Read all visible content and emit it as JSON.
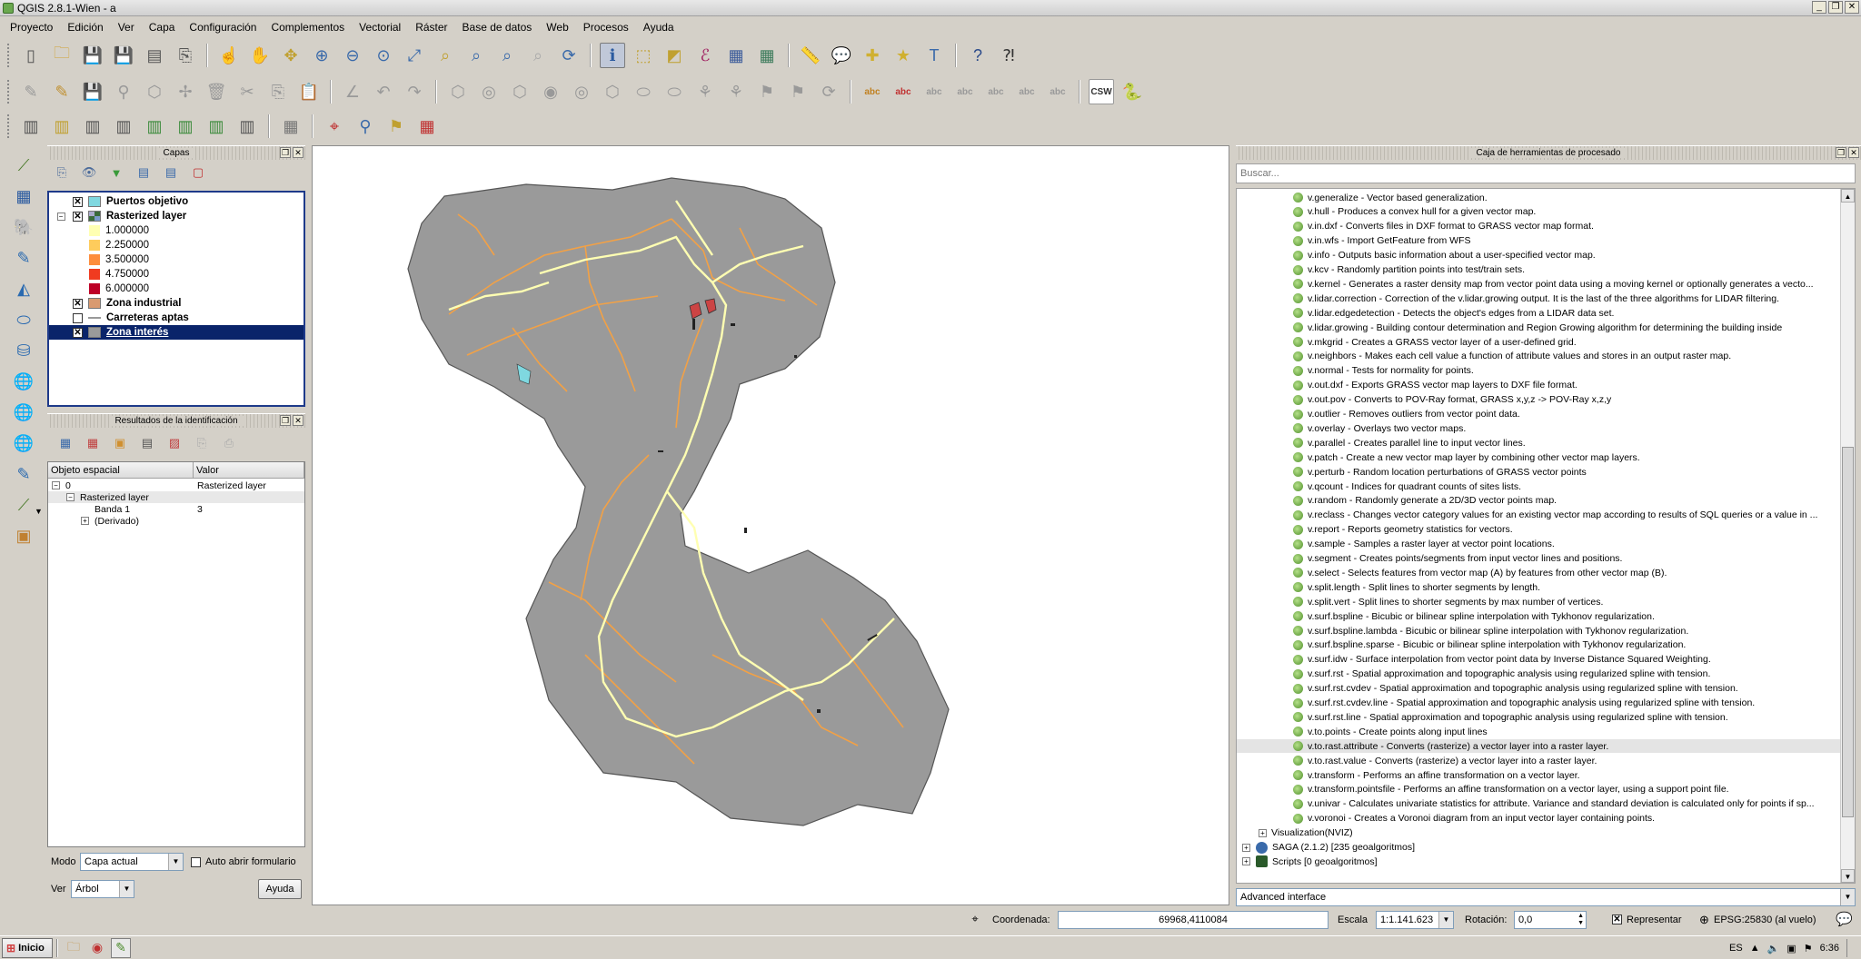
{
  "window": {
    "title": "QGIS 2.8.1-Wien - a"
  },
  "menus": [
    "Proyecto",
    "Edición",
    "Ver",
    "Capa",
    "Configuración",
    "Complementos",
    "Vectorial",
    "Ráster",
    "Base de datos",
    "Web",
    "Procesos",
    "Ayuda"
  ],
  "toolbars": {
    "main_icons": [
      "new-project-icon",
      "open-project-icon",
      "save-project-icon",
      "save-as-icon",
      "new-print-composer-icon",
      "composer-manager-icon",
      "touch-pan-icon",
      "pan-icon",
      "pan-to-selection-icon",
      "zoom-in-icon",
      "zoom-out-icon",
      "zoom-actual-icon",
      "zoom-full-icon",
      "zoom-selection-icon",
      "zoom-layer-icon",
      "zoom-last-icon",
      "zoom-next-icon",
      "refresh-icon",
      "identify-icon",
      "select-feature-icon",
      "deselect-icon",
      "expression-select-icon",
      "attribute-table-icon",
      "field-calculator-icon",
      "measure-icon",
      "map-tips-icon",
      "new-bookmark-icon",
      "show-bookmarks-icon",
      "text-annotation-icon",
      "help-contents-icon",
      "whats-this-icon"
    ],
    "digitizing_icons": [
      "current-edits-icon",
      "toggle-editing-icon",
      "save-edits-icon",
      "add-feature-icon",
      "move-feature-icon",
      "node-tool-icon",
      "delete-selected-icon",
      "cut-features-icon",
      "copy-features-icon",
      "paste-features-icon",
      "measure-angle-icon",
      "undo-icon",
      "redo-icon",
      "simplify-icon",
      "add-ring-icon",
      "add-part-icon",
      "fill-ring-icon",
      "delete-ring-icon",
      "delete-part-icon",
      "reshape-icon",
      "offset-curve-icon",
      "split-parts-icon",
      "split-features-icon",
      "merge-features-icon",
      "merge-attributes-icon",
      "rotate-point-icon",
      "label-icon",
      "label-pin-icon",
      "label-show-hide-icon",
      "label-move-icon",
      "label-rotate-icon",
      "label-change-icon",
      "label-layer-icon",
      "csw-icon",
      "python-console-icon"
    ],
    "raster_icons": [
      "histogram-stretch-icon",
      "local-histogram-icon",
      "full-extent-stretch-icon",
      "local-extent-stretch-icon",
      "increase-brightness-icon",
      "decrease-brightness-icon",
      "increase-contrast-icon",
      "decrease-contrast-icon",
      "georeferencer-icon",
      "coordinate-capture-icon",
      "gps-tools-icon",
      "topology-checker-icon",
      "heatmap-icon"
    ],
    "csw_label": "CSW"
  },
  "layers_panel": {
    "title": "Capas",
    "layers": [
      {
        "name": "Puertos objetivo",
        "checked": true,
        "swatch": "#7fd8e0"
      },
      {
        "name": "Rasterized layer",
        "checked": true,
        "swatch": "raster"
      },
      {
        "name": "Zona industrial",
        "checked": true,
        "swatch": "#d99a70"
      },
      {
        "name": "Carreteras aptas",
        "checked": false,
        "swatch": "line"
      },
      {
        "name": "Zona interés",
        "checked": true,
        "swatch": "#9a9a9a"
      }
    ],
    "legend": [
      {
        "label": "1.000000",
        "color": "#ffffb2"
      },
      {
        "label": "2.250000",
        "color": "#fecc5c"
      },
      {
        "label": "3.500000",
        "color": "#fd8d3c"
      },
      {
        "label": "4.750000",
        "color": "#f03b20"
      },
      {
        "label": "6.000000",
        "color": "#bd0026"
      }
    ]
  },
  "identify_panel": {
    "title": "Resultados de la identificación",
    "col_feature": "Objeto espacial",
    "col_value": "Valor",
    "rows": [
      {
        "label": "0",
        "value": "Rasterized layer",
        "indent": 0,
        "expander": "−"
      },
      {
        "label": "Rasterized layer",
        "value": "",
        "indent": 1,
        "expander": "−"
      },
      {
        "label": "Banda 1",
        "value": "3",
        "indent": 2,
        "expander": ""
      },
      {
        "label": "(Derivado)",
        "value": "",
        "indent": 2,
        "expander": "+"
      }
    ],
    "mode_label": "Modo",
    "mode_value": "Capa actual",
    "auto_open_label": "Auto abrir formulario",
    "view_label": "Ver",
    "view_value": "Árbol",
    "help_label": "Ayuda"
  },
  "processing": {
    "title": "Caja de herramientas de procesado",
    "search_placeholder": "Buscar...",
    "algorithms": [
      "v.generalize - Vector based generalization.",
      "v.hull - Produces a convex hull for a given vector map.",
      "v.in.dxf - Converts files in DXF format to GRASS vector map format.",
      "v.in.wfs - Import GetFeature from WFS",
      "v.info - Outputs basic information about a user-specified vector map.",
      "v.kcv - Randomly partition points into test/train sets.",
      "v.kernel - Generates a raster density map from vector point data using a moving kernel or optionally generates a vecto...",
      "v.lidar.correction - Correction of the v.lidar.growing output. It is the last of the three algorithms for LIDAR filtering.",
      "v.lidar.edgedetection - Detects the object's edges from a LIDAR data set.",
      "v.lidar.growing - Building contour determination and Region Growing algorithm for determining the building inside",
      "v.mkgrid - Creates a GRASS vector layer of a user-defined grid.",
      "v.neighbors - Makes each cell value a function of attribute values and stores in an output raster map.",
      "v.normal - Tests for normality for points.",
      "v.out.dxf - Exports GRASS vector map layers to DXF file format.",
      "v.out.pov - Converts to POV-Ray format, GRASS x,y,z -> POV-Ray x,z,y",
      "v.outlier - Removes outliers from vector point data.",
      "v.overlay - Overlays two vector maps.",
      "v.parallel - Creates parallel line to input vector lines.",
      "v.patch - Create a new vector map layer by combining other vector map layers.",
      "v.perturb - Random location perturbations of GRASS vector points",
      "v.qcount - Indices for quadrant counts of sites lists.",
      "v.random - Randomly generate a 2D/3D vector points map.",
      "v.reclass - Changes vector category values for an existing vector map according to results of SQL queries or a value in ...",
      "v.report - Reports geometry statistics for vectors.",
      "v.sample - Samples a raster layer at vector point locations.",
      "v.segment - Creates points/segments from input vector lines and positions.",
      "v.select - Selects features from vector map (A) by features from other vector map (B).",
      "v.split.length - Split lines to shorter segments by length.",
      "v.split.vert - Split lines to shorter segments by max number of vertices.",
      "v.surf.bspline - Bicubic or bilinear spline interpolation with Tykhonov regularization.",
      "v.surf.bspline.lambda - Bicubic or bilinear spline interpolation with Tykhonov regularization.",
      "v.surf.bspline.sparse - Bicubic or bilinear spline interpolation with Tykhonov regularization.",
      "v.surf.idw - Surface interpolation from vector point data by Inverse Distance Squared Weighting.",
      "v.surf.rst - Spatial approximation and topographic analysis using regularized spline with tension.",
      "v.surf.rst.cvdev - Spatial approximation and topographic analysis using regularized spline with tension.",
      "v.surf.rst.cvdev.line - Spatial approximation and topographic analysis using regularized spline with tension.",
      "v.surf.rst.line - Spatial approximation and topographic analysis using regularized spline with tension.",
      "v.to.points - Create points along input lines",
      "v.to.rast.attribute - Converts (rasterize) a vector layer into a raster layer.",
      "v.to.rast.value - Converts (rasterize) a vector layer into a raster layer.",
      "v.transform - Performs an affine transformation on a vector layer.",
      "v.transform.pointsfile - Performs an affine transformation on a vector layer, using a support point file.",
      "v.univar - Calculates univariate statistics for attribute. Variance and standard deviation is calculated only for points if sp...",
      "v.voronoi - Creates a Voronoi diagram from an input vector layer containing points."
    ],
    "highlighted": "v.to.rast.attribute - Converts (rasterize) a vector layer into a raster layer.",
    "groups": [
      "Visualization(NVIZ)",
      "SAGA (2.1.2) [235 geoalgoritmos]",
      "Scripts [0 geoalgoritmos]"
    ],
    "advanced": "Advanced interface"
  },
  "statusbar": {
    "coord_label": "Coordenada:",
    "coord_value": "69968,4110084",
    "scale_label": "Escala",
    "scale_value": "1:1.141.623",
    "rotation_label": "Rotación:",
    "rotation_value": "0,0",
    "render_label": "Representar",
    "crs": "EPSG:25830 (al vuelo)"
  },
  "taskbar": {
    "start": "Inicio",
    "lang": "ES",
    "time": "6:36"
  },
  "colors": {
    "selection": "#0a246a",
    "map_fill": "#9a9a9a",
    "road_orange": "#f2a146",
    "road_yellow": "#ffffb2"
  }
}
